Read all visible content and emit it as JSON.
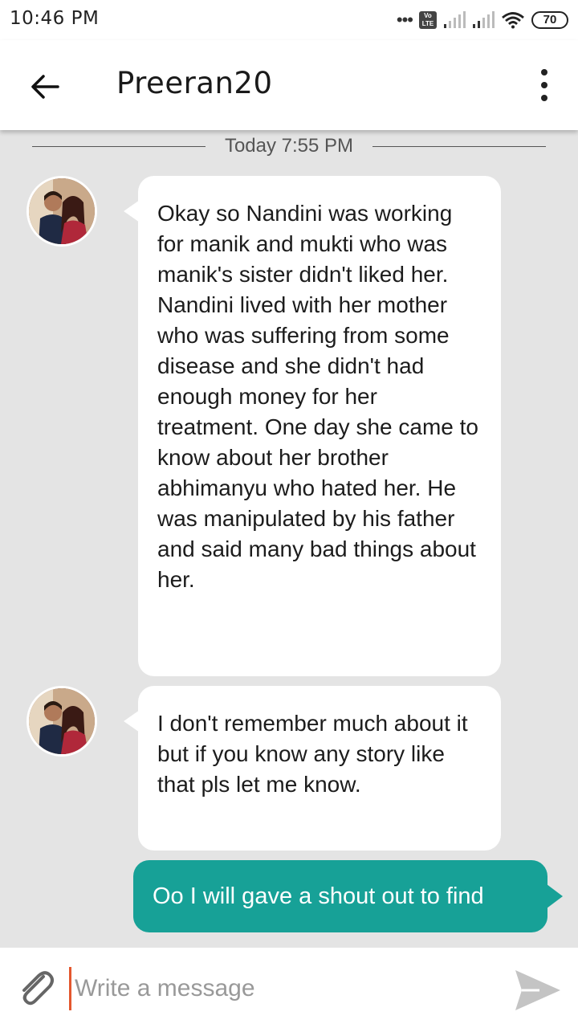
{
  "status_bar": {
    "time": "10:46 PM",
    "volte": "Vo LTE",
    "battery": "70",
    "icons": [
      "more-dots-icon",
      "volte-icon",
      "signal-icon",
      "signal-icon",
      "wifi-icon",
      "battery-icon"
    ]
  },
  "header": {
    "title": "Preeran20",
    "back_icon": "arrow-left-icon",
    "menu_icon": "more-vertical-icon"
  },
  "chat": {
    "date_divider": "Today 7:55 PM",
    "messages": [
      {
        "direction": "incoming",
        "text": "Okay so Nandini was working for manik and mukti who was manik's sister didn't liked her. Nandini lived with her mother who was suffering from some disease and she didn't had enough money for her treatment. One day she came to know about her brother abhimanyu who hated her. He was manipulated by his father and said many bad things about her."
      },
      {
        "direction": "incoming",
        "text": "I don't remember much about it but if you know any story like that pls let me know."
      },
      {
        "direction": "outgoing",
        "text": "Oo I will gave a shout out to find"
      }
    ]
  },
  "composer": {
    "placeholder": "Write a message",
    "value": "",
    "attach_icon": "paperclip-icon",
    "send_icon": "send-icon"
  },
  "colors": {
    "background": "#e4e4e4",
    "outgoing_bubble": "#17a197",
    "incoming_bubble": "#ffffff",
    "cursor": "#e4572e"
  }
}
